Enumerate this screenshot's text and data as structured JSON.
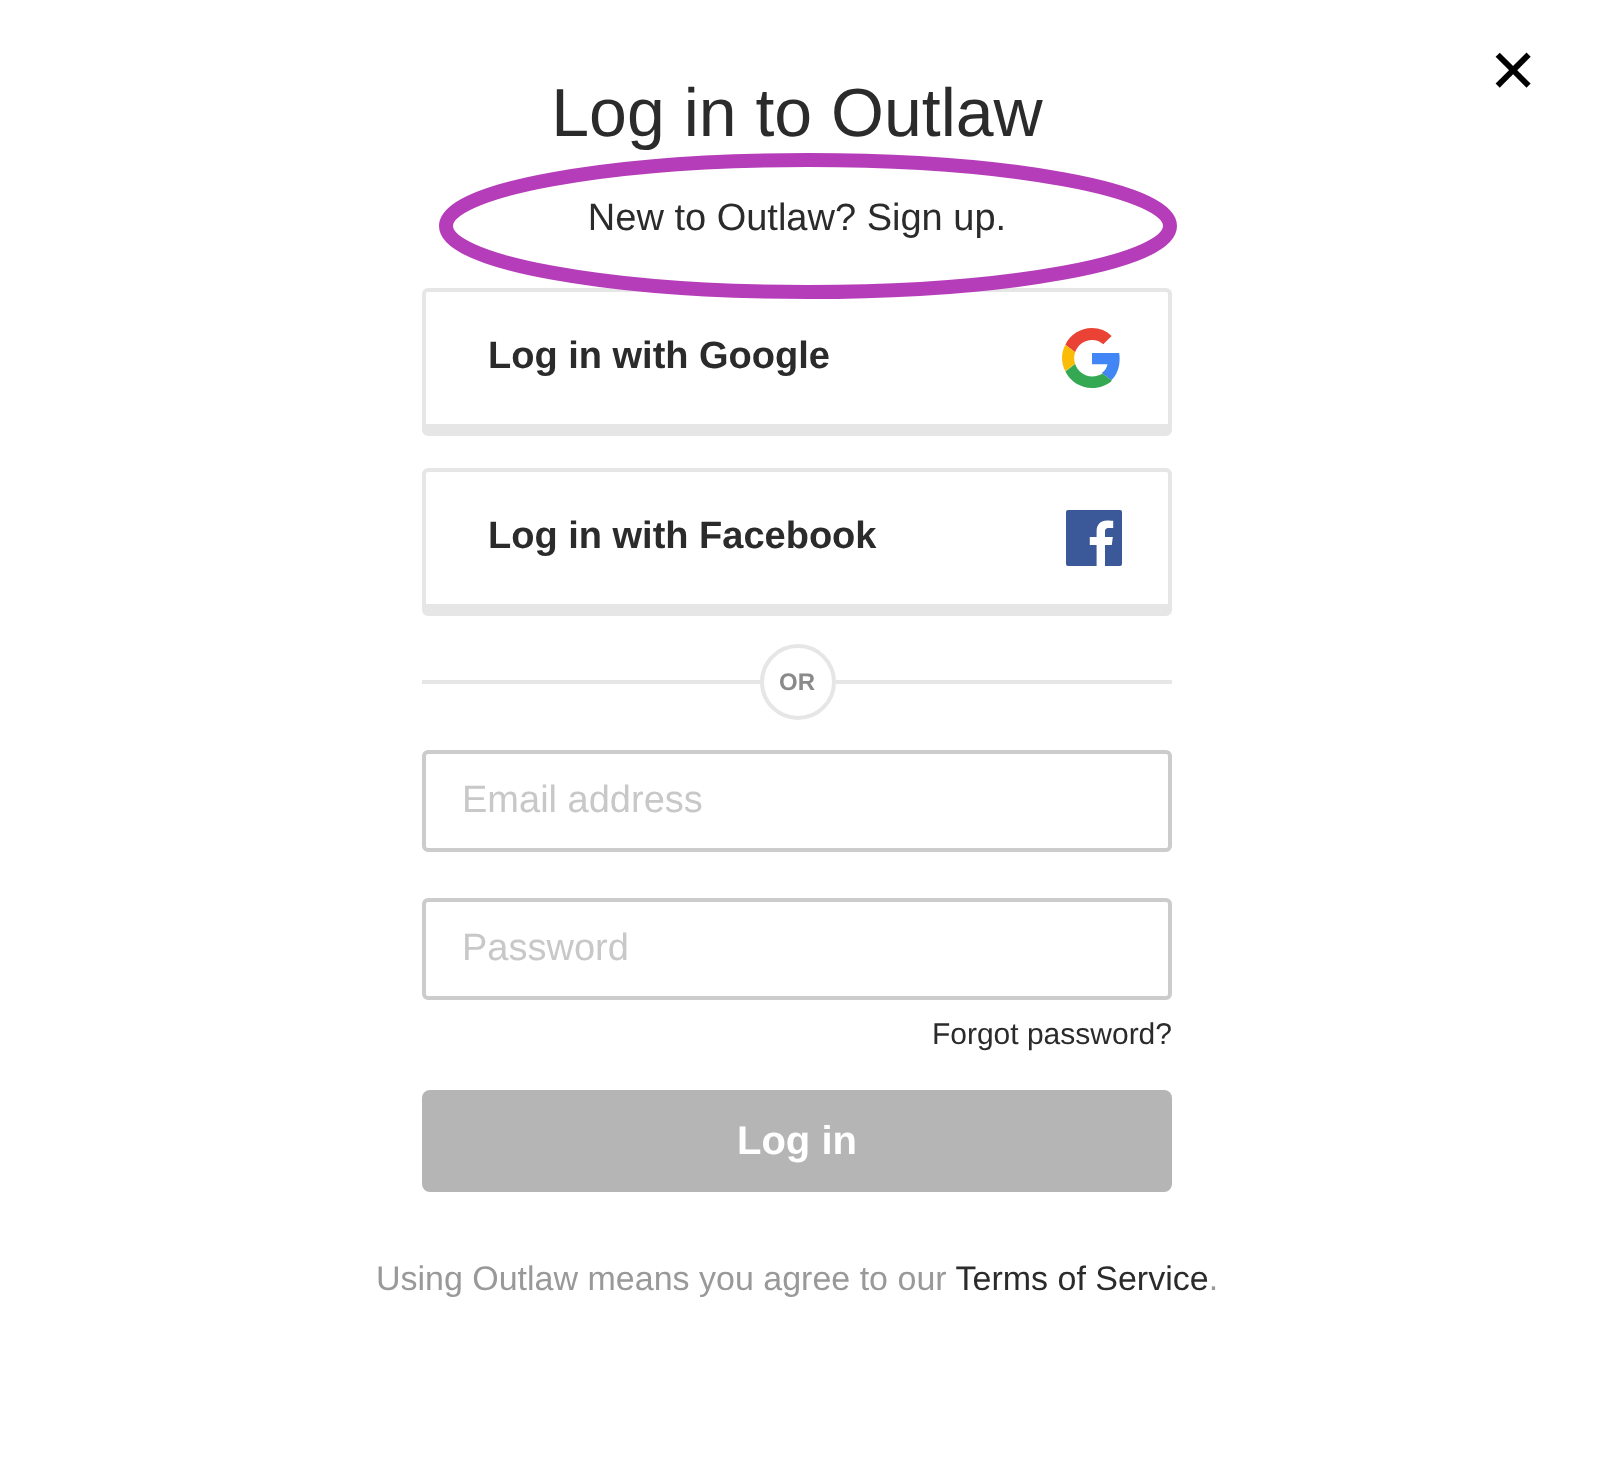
{
  "close": {
    "label": "✕"
  },
  "title": "Log in to Outlaw",
  "subtitle": {
    "text": "New to Outlaw?",
    "link": "Sign up."
  },
  "social_buttons": [
    {
      "kind": "google",
      "label": "Log in with Google"
    },
    {
      "kind": "facebook",
      "label": "Log in with Facebook"
    }
  ],
  "divider": "OR",
  "fields": [
    {
      "placeholder": "Email address"
    },
    {
      "placeholder": "Password"
    }
  ],
  "forgot_link": "Forgot password?",
  "submit": {
    "label": "Log in",
    "disabled": true
  },
  "footer": {
    "text": "Using Outlaw means you agree to our",
    "link": "Terms of Service",
    "end": "."
  }
}
